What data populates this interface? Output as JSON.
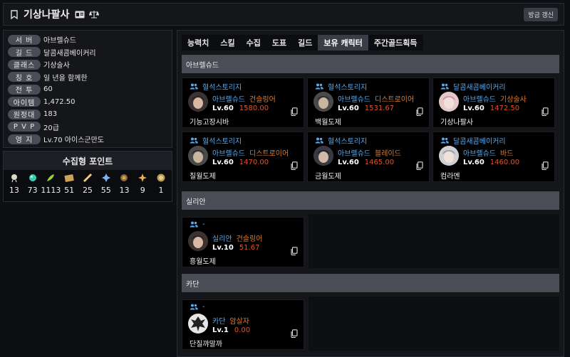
{
  "header": {
    "title": "기상나팔사",
    "refresh_label": "방금 갱신"
  },
  "profile": [
    {
      "label": "서 버",
      "value": "아브렐슈드"
    },
    {
      "label": "길 드",
      "value": "달콤새콤베이커리"
    },
    {
      "label": "클래스",
      "value": "기상술사"
    },
    {
      "label": "칭 호",
      "value": "일 년을 함께한"
    },
    {
      "label": "전 투",
      "value": "60"
    },
    {
      "label": "아이템",
      "value": "1,472.50"
    },
    {
      "label": "원정대",
      "value": "183"
    },
    {
      "label": "P V P",
      "value": "20급"
    },
    {
      "label": "영 지",
      "value": "Lv.70 아이스군만도"
    }
  ],
  "collect": {
    "title": "수집형 포인트",
    "items": [
      {
        "icon": "mokoko-seed-icon",
        "value": "13"
      },
      {
        "icon": "island-heart-icon",
        "value": "73"
      },
      {
        "icon": "world-tree-leaf-icon",
        "value": "1113"
      },
      {
        "icon": "art-piece-icon",
        "value": "51"
      },
      {
        "icon": "voyage-memento-icon",
        "value": "25"
      },
      {
        "icon": "ignea-token-icon",
        "value": "55"
      },
      {
        "icon": "orpheus-star-icon",
        "value": "13"
      },
      {
        "icon": "giants-heart-icon",
        "value": "9"
      },
      {
        "icon": "omnium-star-icon",
        "value": "1"
      }
    ]
  },
  "tabs": [
    "능력치",
    "스킬",
    "수집",
    "도표",
    "길드",
    "보유 캐릭터",
    "주간골드획득"
  ],
  "active_tab": 5,
  "sections": [
    {
      "name": "아브렐슈드",
      "cards": [
        {
          "guild": "혈석스토리지",
          "server": "아브렐슈드",
          "cls": "건슬링어",
          "lv": "Lv.60",
          "ilvl": "1580.00",
          "name": "기능고장시바"
        },
        {
          "guild": "혈석스토리지",
          "server": "아브렐슈드",
          "cls": "디스트로이어",
          "lv": "Lv.60",
          "ilvl": "1531.67",
          "name": "백월도제"
        },
        {
          "guild": "달콤새콤베이커리",
          "server": "아브렐슈드",
          "cls": "기상술사",
          "lv": "Lv.60",
          "ilvl": "1472.50",
          "name": "기상나팔사"
        },
        {
          "guild": "혈석스토리지",
          "server": "아브렐슈드",
          "cls": "디스트로이어",
          "lv": "Lv.60",
          "ilvl": "1470.00",
          "name": "칠월도제"
        },
        {
          "guild": "혈석스토리지",
          "server": "아브렐슈드",
          "cls": "블레이드",
          "lv": "Lv.60",
          "ilvl": "1465.00",
          "name": "금월도제"
        },
        {
          "guild": "달콤새콤베이커리",
          "server": "아브렐슈드",
          "cls": "바드",
          "lv": "Lv.60",
          "ilvl": "1460.00",
          "name": "컴라멘"
        }
      ]
    },
    {
      "name": "실리안",
      "cards": [
        {
          "guild": "-",
          "server": "실리안",
          "cls": "건슬링어",
          "lv": "Lv.10",
          "ilvl": "51.67",
          "name": "흥월도제"
        }
      ]
    },
    {
      "name": "카단",
      "cards": [
        {
          "guild": "-",
          "server": "카단",
          "cls": "암살자",
          "lv": "Lv.1",
          "ilvl": "0.00",
          "name": "단질꺄말까"
        }
      ]
    }
  ],
  "colors": {
    "accent_blue": "#5ba8ea",
    "class_orange": "#e07a2b",
    "ilvl_red": "#e0522b",
    "section_gray": "#4a4d55"
  }
}
